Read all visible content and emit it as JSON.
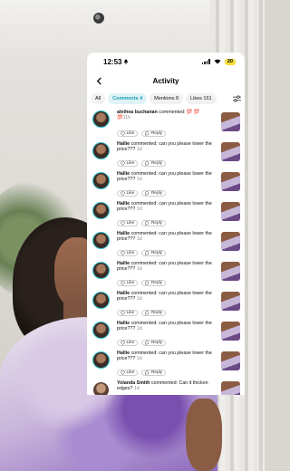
{
  "status": {
    "time": "12:53",
    "battery": "20"
  },
  "header": {
    "title": "Activity"
  },
  "tabs": [
    {
      "label": "All"
    },
    {
      "label": "Comments 4"
    },
    {
      "label": "Mentions 8"
    },
    {
      "label": "Likes 161"
    }
  ],
  "actions": {
    "like": "Like",
    "reply": "Reply"
  },
  "comments": [
    {
      "user": "alethea buchanan",
      "text": " commented: 💯 💯 💯",
      "time": "11h"
    },
    {
      "user": "Hallie",
      "text": " commented: can you please lower the price??? ",
      "time": "1d"
    },
    {
      "user": "Hallie",
      "text": " commented: can you please lower the price??? ",
      "time": "1d"
    },
    {
      "user": "Hallie",
      "text": " commented: can you please lower the price??? ",
      "time": "1d"
    },
    {
      "user": "Hallie",
      "text": " commented: can you please lower the price??? ",
      "time": "1d"
    },
    {
      "user": "Hallie",
      "text": " commented: can you please lower the price??? ",
      "time": "1d"
    },
    {
      "user": "Hallie",
      "text": " commented: can you please lower the price??? ",
      "time": "1d"
    },
    {
      "user": "Hallie",
      "text": " commented: can you please lower the price??? ",
      "time": "1d"
    },
    {
      "user": "Hallie",
      "text": " commented: can you please lower the price??? ",
      "time": "1d"
    },
    {
      "user": "Yolanda Smith",
      "text": " commented: Can it thicken edges? ",
      "time": "1d"
    }
  ]
}
